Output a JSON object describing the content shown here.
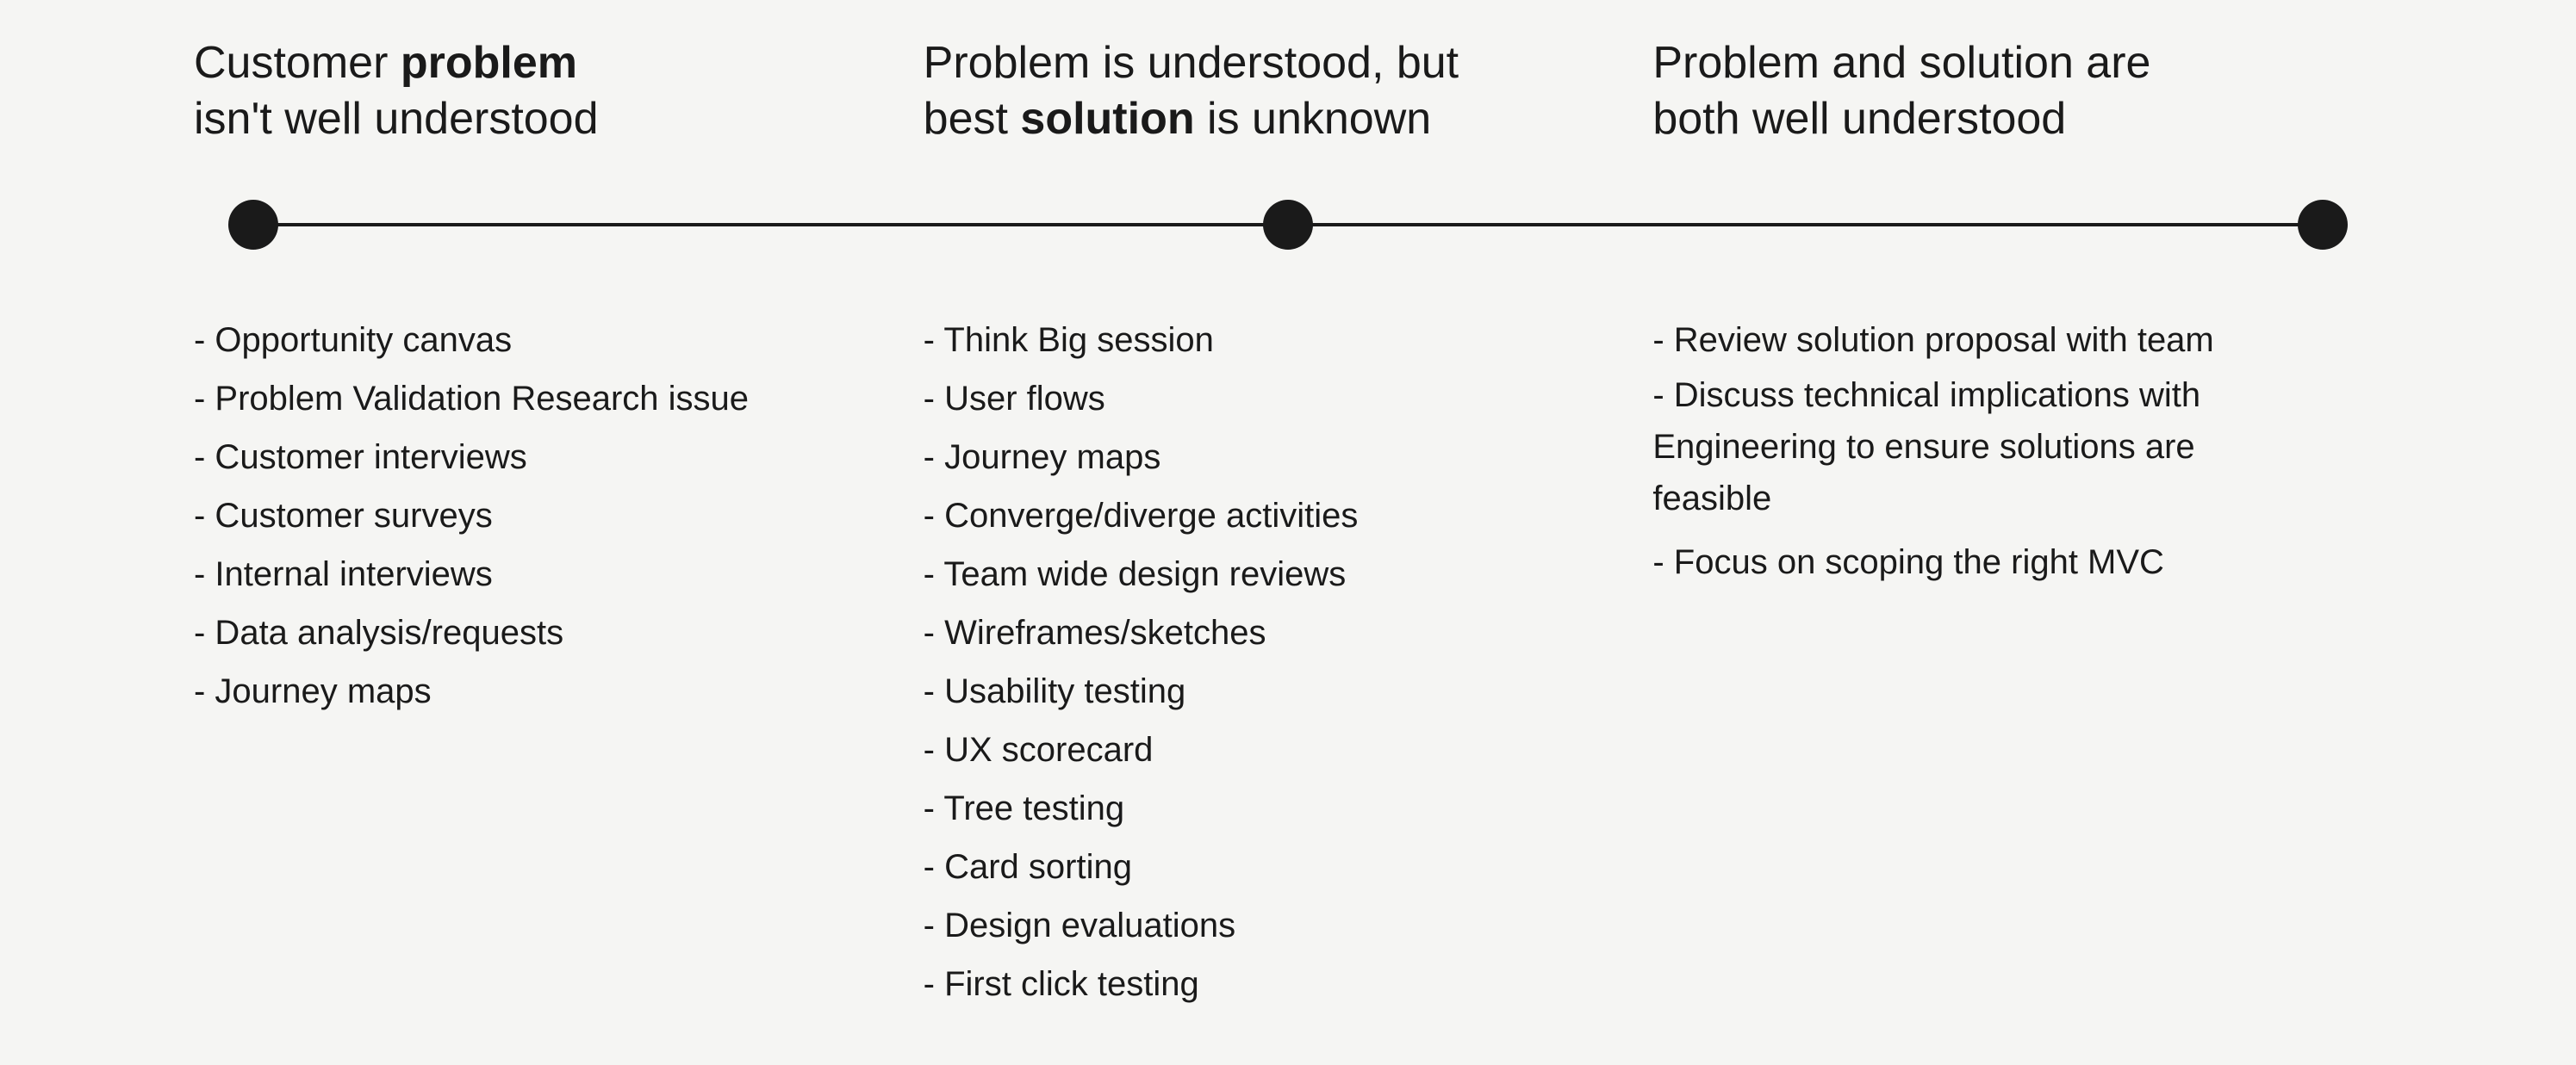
{
  "headings": {
    "col1": {
      "part1": "Customer ",
      "bold": "problem",
      "part2": "\nisn't well understood"
    },
    "col2": {
      "part1": "Problem is understood, but\nbest ",
      "bold": "solution",
      "part2": " is unknown"
    },
    "col3": {
      "text": "Problem and solution are\nboth well understood"
    }
  },
  "content": {
    "col1": [
      "- Opportunity canvas",
      "- Problem Validation Research issue",
      "- Customer interviews",
      "- Customer surveys",
      "- Internal interviews",
      "- Data analysis/requests",
      "- Journey maps"
    ],
    "col2": [
      "- Think Big session",
      "- User flows",
      "- Journey maps",
      "- Converge/diverge activities",
      "- Team wide design reviews",
      "- Wireframes/sketches",
      "- Usability testing",
      "- UX scorecard",
      "- Tree testing",
      "- Card sorting",
      "- Design evaluations",
      "- First click testing"
    ],
    "col3": [
      "- Review solution proposal with team",
      "- Discuss technical implications with\nEngineering to ensure solutions are\nfeasible",
      "- Focus on scoping the right MVC"
    ]
  }
}
